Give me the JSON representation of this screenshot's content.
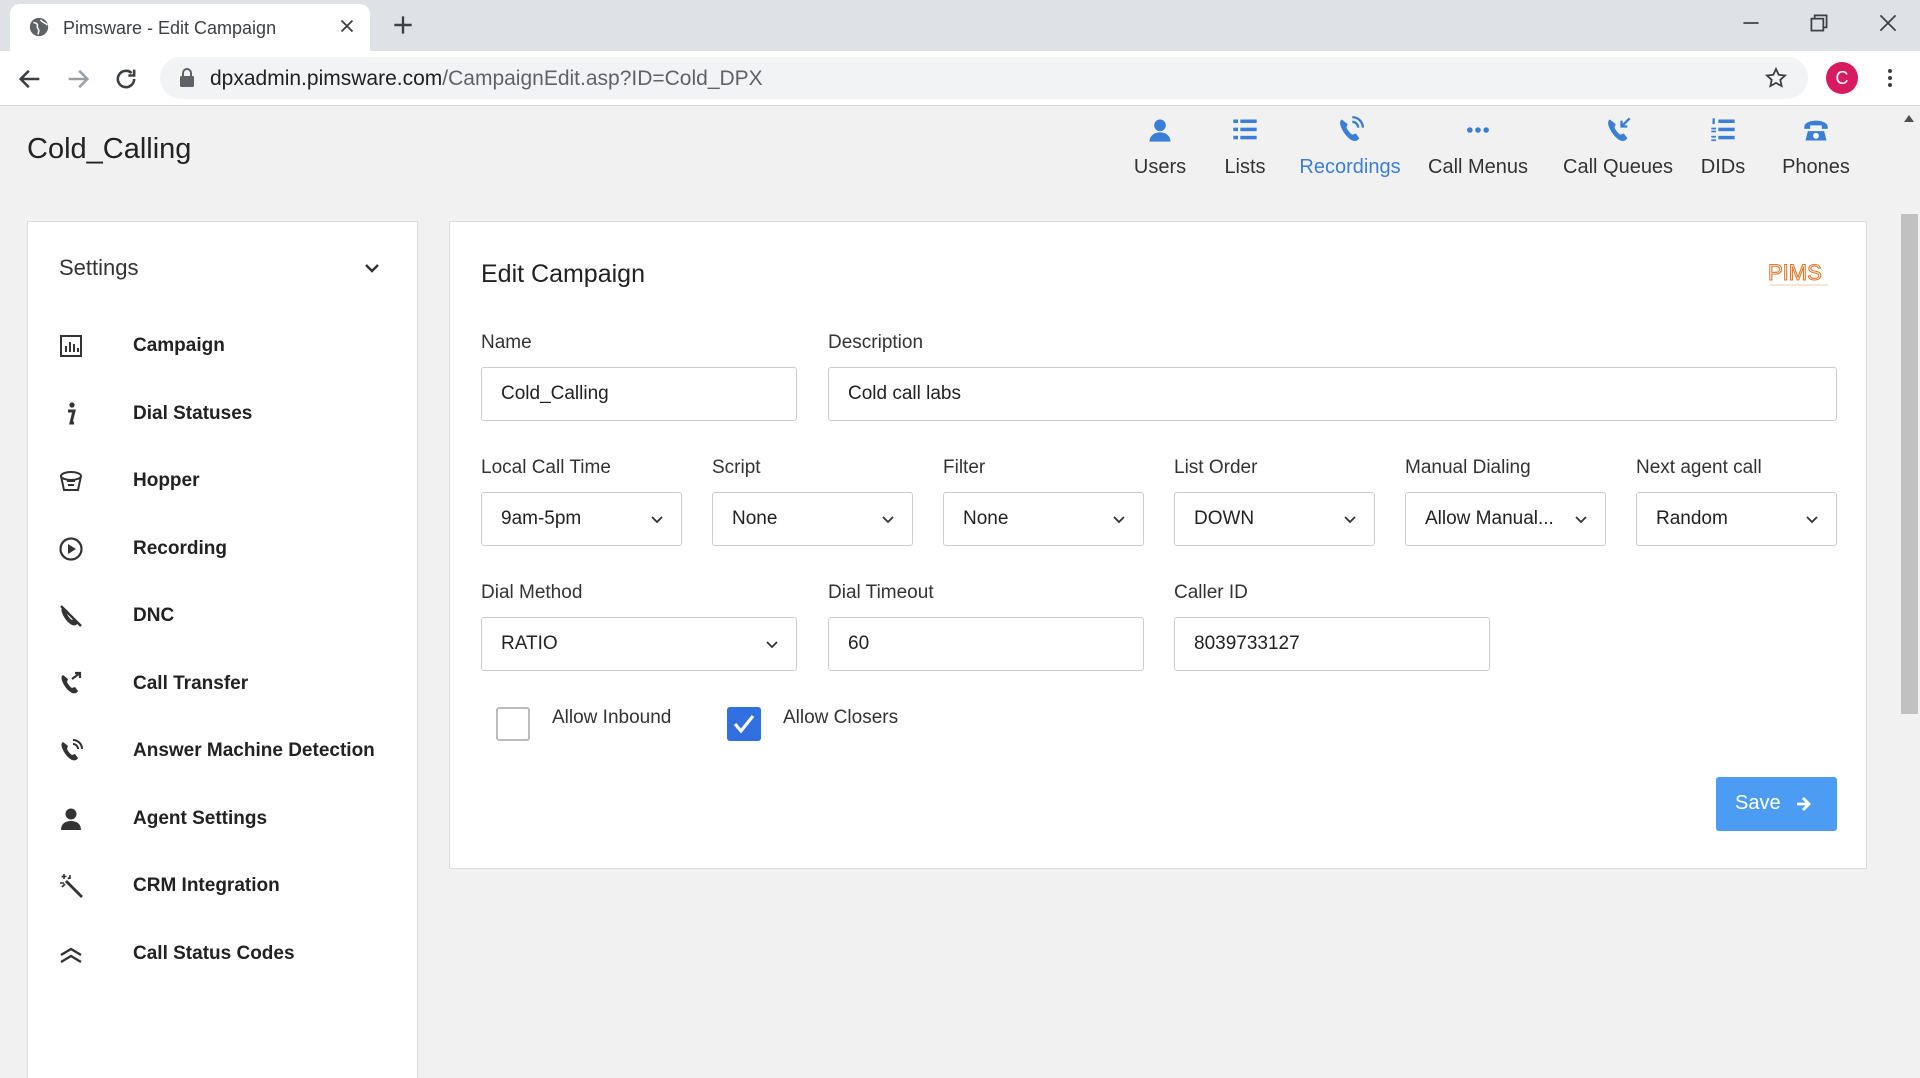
{
  "browser": {
    "tab_title": "Pimsware - Edit Campaign",
    "url_host": "dpxadmin.pimsware.com",
    "url_path": "/CampaignEdit.asp?ID=Cold_DPX",
    "profile_initial": "C"
  },
  "page": {
    "title": "Cold_Calling"
  },
  "topnav": {
    "items": [
      {
        "label": "Users",
        "icon": "user-icon"
      },
      {
        "label": "Lists",
        "icon": "list-icon"
      },
      {
        "label": "Recordings",
        "icon": "phone-volume-icon",
        "active": true
      },
      {
        "label": "Call Menus",
        "icon": "ellipsis-icon"
      },
      {
        "label": "Call Queues",
        "icon": "phone-incoming-icon"
      },
      {
        "label": "DIDs",
        "icon": "numbered-list-icon"
      },
      {
        "label": "Phones",
        "icon": "phone-icon"
      }
    ],
    "active_color": "#3a7fd5"
  },
  "sidebar": {
    "heading": "Settings",
    "items": [
      {
        "label": "Campaign",
        "icon": "chart-bar-icon"
      },
      {
        "label": "Dial Statuses",
        "icon": "info-icon"
      },
      {
        "label": "Hopper",
        "icon": "bucket-icon"
      },
      {
        "label": "Recording",
        "icon": "play-circle-icon"
      },
      {
        "label": "DNC",
        "icon": "phone-slash-icon"
      },
      {
        "label": "Call Transfer",
        "icon": "phone-transfer-icon"
      },
      {
        "label": "Answer Machine Detection",
        "icon": "phone-volume-icon"
      },
      {
        "label": "Agent Settings",
        "icon": "user-icon"
      },
      {
        "label": "CRM Integration",
        "icon": "magic-wand-icon"
      },
      {
        "label": "Call Status Codes",
        "icon": "chevrons-up-icon"
      }
    ]
  },
  "form": {
    "title": "Edit Campaign",
    "logo_text": "PIMS",
    "name": {
      "label": "Name",
      "value": "Cold_Calling"
    },
    "description": {
      "label": "Description",
      "value": "Cold call labs"
    },
    "local_call_time": {
      "label": "Local Call Time",
      "value": "9am-5pm"
    },
    "script": {
      "label": "Script",
      "value": "None"
    },
    "filter": {
      "label": "Filter",
      "value": "None"
    },
    "list_order": {
      "label": "List Order",
      "value": "DOWN"
    },
    "manual_dialing": {
      "label": "Manual Dialing",
      "value": "Allow Manual..."
    },
    "next_agent_call": {
      "label": "Next agent call",
      "value": "Random"
    },
    "dial_method": {
      "label": "Dial Method",
      "value": "RATIO"
    },
    "dial_timeout": {
      "label": "Dial Timeout",
      "value": "60"
    },
    "caller_id": {
      "label": "Caller ID",
      "value": "8039733127"
    },
    "allow_inbound": {
      "label": "Allow Inbound",
      "checked": false
    },
    "allow_closers": {
      "label": "Allow Closers",
      "checked": true
    },
    "save_label": "Save",
    "save_color": "#4d9cf3"
  }
}
